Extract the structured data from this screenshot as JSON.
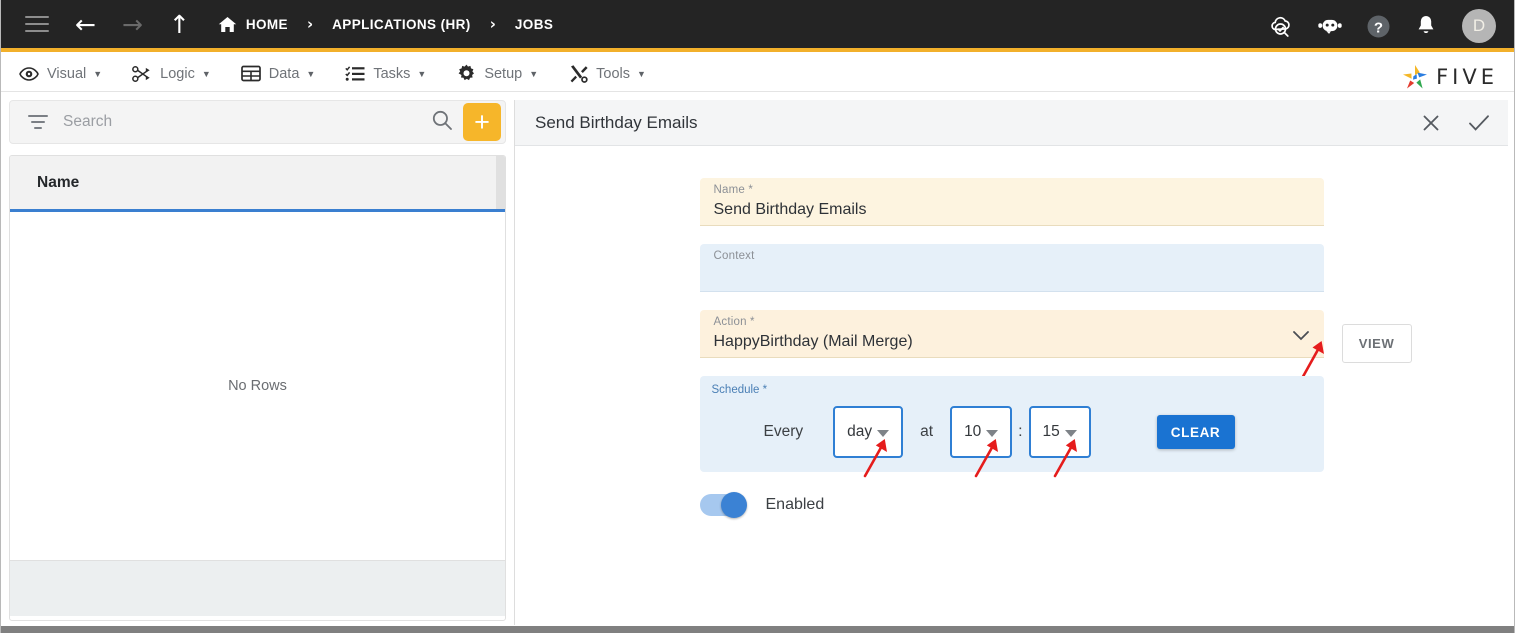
{
  "topbar": {
    "icons": {
      "menu": "hamburger-icon",
      "back": "back-arrow-icon",
      "forward": "forward-arrow-icon",
      "up": "up-arrow-icon",
      "home": "home-icon"
    },
    "breadcrumb": [
      {
        "label": "HOME",
        "icon": "home-icon"
      },
      {
        "label": "APPLICATIONS (HR)"
      },
      {
        "label": "JOBS"
      }
    ],
    "separator": "›",
    "right_icons": [
      {
        "name": "cloud-check-icon"
      },
      {
        "name": "chatbot-icon"
      },
      {
        "name": "help-icon"
      },
      {
        "name": "notification-bell-icon"
      }
    ],
    "avatar_initial": "D"
  },
  "menubar": {
    "items": [
      {
        "label": "Visual",
        "icon": "eye-icon"
      },
      {
        "label": "Logic",
        "icon": "logic-graph-icon"
      },
      {
        "label": "Data",
        "icon": "table-icon"
      },
      {
        "label": "Tasks",
        "icon": "checklist-icon"
      },
      {
        "label": "Setup",
        "icon": "gear-icon"
      },
      {
        "label": "Tools",
        "icon": "tools-icon"
      }
    ],
    "caret": "▼",
    "brand": "FIVE"
  },
  "left_panel": {
    "search": {
      "placeholder": "Search",
      "value": "",
      "filter_icon": "filter-icon",
      "search_icon": "search-icon"
    },
    "add_button_label": "+",
    "grid": {
      "columns": [
        "Name"
      ],
      "rows": [],
      "empty_message": "No Rows"
    }
  },
  "right_panel": {
    "title": "Send Birthday Emails",
    "actions": [
      {
        "name": "close-icon",
        "glyph": "✕"
      },
      {
        "name": "confirm-check-icon",
        "glyph": "✓"
      }
    ],
    "fields": {
      "name": {
        "label": "Name *",
        "value": "Send Birthday Emails"
      },
      "context": {
        "label": "Context",
        "value": ""
      },
      "action": {
        "label": "Action *",
        "value": "HappyBirthday (Mail Merge)"
      }
    },
    "view_button_label": "VIEW",
    "schedule": {
      "label": "Schedule *",
      "every_word": "Every",
      "interval": "day",
      "at_word": "at",
      "hour": "10",
      "colon": ":",
      "minute": "15",
      "clear_button_label": "CLEAR"
    },
    "enabled": {
      "label": "Enabled",
      "state": "on"
    }
  },
  "colors": {
    "topbar_bg": "#242424",
    "accent_yellow": "#f2b02b",
    "add_button": "#f6b62a",
    "grid_header_underline": "#3a7fd0",
    "primary_blue": "#1a73d2",
    "required_field_bg": "#fdf4e0",
    "optional_field_bg": "#e6f0f9",
    "annotation_arrow": "#e51c1c",
    "toggle_on_track": "#a6c8ef",
    "toggle_on_knob": "#3b82d4"
  }
}
